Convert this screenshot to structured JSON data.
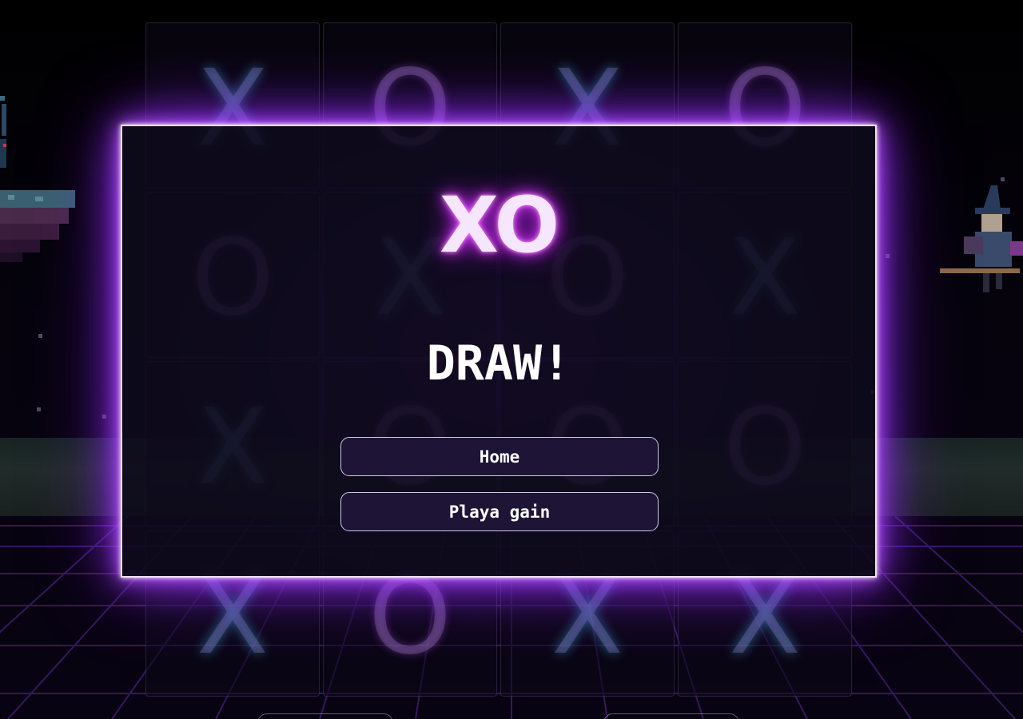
{
  "modal": {
    "logo": "XO",
    "result": "DRAW!",
    "buttons": {
      "home": "Home",
      "play_again": "Playa gain"
    }
  },
  "board": {
    "cells": [
      "X",
      "O",
      "X",
      "O",
      "O",
      "X",
      "O",
      "X",
      "X",
      "O",
      "O",
      "O",
      "X",
      "O",
      "X",
      "X"
    ]
  },
  "colors": {
    "neon_purple": "#c060ff",
    "modal_border": "#f0dcff",
    "button_bg": "#1e1436"
  }
}
